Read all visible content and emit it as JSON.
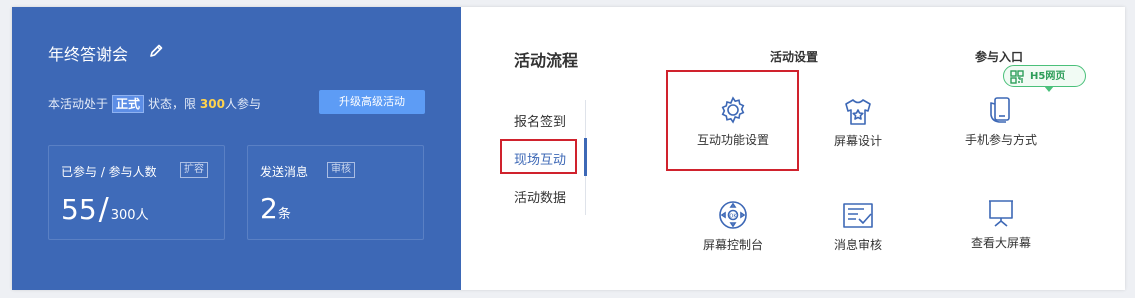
{
  "event": {
    "title": "年终答谢会",
    "status_prefix": "本活动处于",
    "status_badge": "正式",
    "status_mid": "状态，限",
    "limit": "300",
    "status_suffix": "人参与",
    "upgrade_label": "升级高级活动"
  },
  "stats": [
    {
      "label": "已参与 / 参与人数",
      "tag": "扩容",
      "value": "55",
      "slash": "/",
      "sub": "300",
      "unit": "人"
    },
    {
      "label": "发送消息",
      "tag": "审核",
      "value": "2",
      "unit": "条"
    }
  ],
  "flow": {
    "title": "活动流程",
    "items": [
      "报名签到",
      "现场互动",
      "活动数据"
    ],
    "active_index": 1
  },
  "columns": [
    "活动设置",
    "参与入口"
  ],
  "features": [
    {
      "label": "互动功能设置",
      "icon": "gear-icon"
    },
    {
      "label": "屏幕设计",
      "icon": "shirt-icon"
    },
    {
      "label": "手机参与方式",
      "icon": "phone-icon"
    },
    {
      "label": "屏幕控制台",
      "icon": "gamepad-icon"
    },
    {
      "label": "消息审核",
      "icon": "message-check-icon"
    },
    {
      "label": "查看大屏幕",
      "icon": "screen-icon"
    }
  ],
  "h5_tag": "H5网页",
  "colors": {
    "primary": "#3d68b6",
    "highlight": "#d0222d",
    "accent_green": "#4ac07a",
    "limit_yellow": "#ffd34d"
  }
}
